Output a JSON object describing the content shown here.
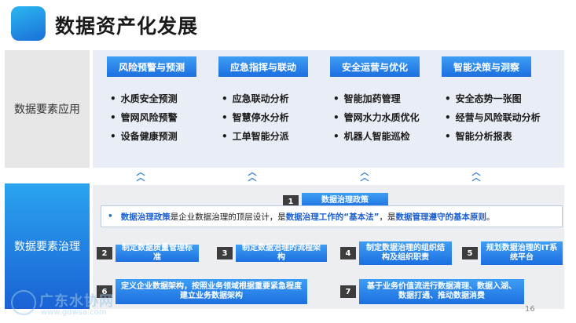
{
  "title": "数据资产化发展",
  "page_number": "16",
  "section_apps": {
    "label": "数据要素应用",
    "categories": [
      {
        "header": "风险预警与预测",
        "items": [
          "水质安全预测",
          "管网风险预警",
          "设备健康预测"
        ]
      },
      {
        "header": "应急指挥与联动",
        "items": [
          "应急联动分析",
          "智慧停水分析",
          "工单智能分派"
        ]
      },
      {
        "header": "安全运营与优化",
        "items": [
          "智能加药管理",
          "管网水力水质优化",
          "机器人智能巡检"
        ]
      },
      {
        "header": "智能决策与洞察",
        "items": [
          "安全态势一张图",
          "经营与风险联动分析",
          "智能分析报表"
        ]
      }
    ]
  },
  "section_gov": {
    "label": "数据要素治理",
    "policy": {
      "num": "1",
      "label": "数据治理政策",
      "desc_hl1": "数据治理政策",
      "desc_t1": "是企业数据治理的顶层设计，是",
      "desc_hl2": "数据治理工作的“基本法”",
      "desc_t2": "，是",
      "desc_hl3": "数据管理遵守的基本原则",
      "desc_t3": "。"
    },
    "items": [
      {
        "num": "2",
        "label": "制定数据质量管理标准"
      },
      {
        "num": "3",
        "label": "制定数据治理的流程架构"
      },
      {
        "num": "4",
        "label": "制定数据治理的组织结构及组织职责"
      },
      {
        "num": "5",
        "label": "规划数据治理的IT系统平台"
      },
      {
        "num": "6",
        "label": "定义企业数据架构，按照业务领域根据重要紧急程度建立业务数据架构"
      },
      {
        "num": "7",
        "label": "基于业务价值流进行数据清理、数据入湖、数据打通、推动数据消费"
      }
    ]
  },
  "watermark": {
    "text": "广东水协网",
    "url": "www.gdwsa.com"
  }
}
